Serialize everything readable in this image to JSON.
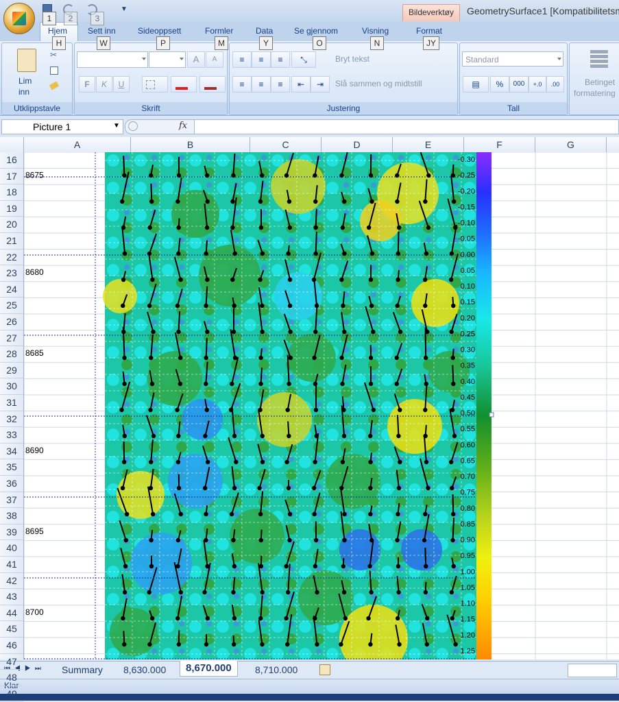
{
  "window": {
    "context_tab": "Bildeverktøy",
    "title": "GeometrySurface1  [Kompatibilitetsmodus]"
  },
  "keytips": {
    "quick1": "1",
    "quick2": "2",
    "quick3": "3",
    "hjem": "H",
    "sett_inn": "W",
    "sideoppsett": "P",
    "formler": "M",
    "data": "Y",
    "se_gjennom": "O",
    "visning": "N",
    "format": "JY"
  },
  "tabs": {
    "hjem": "Hjem",
    "sett_inn": "Sett inn",
    "sideoppsett": "Sideoppsett",
    "formler": "Formler",
    "data": "Data",
    "se_gjennom": "Se gjennom",
    "visning": "Visning",
    "format": "Format"
  },
  "ribbon": {
    "clipboard": {
      "paste_label": "Lim",
      "paste_label2": "inn",
      "group": "Utklippstavle"
    },
    "font": {
      "bold": "F",
      "italic": "K",
      "underline": "U",
      "grow": "A",
      "shrink": "A",
      "group": "Skrift"
    },
    "alignment": {
      "wrap": "Bryt tekst",
      "merge": "Slå sammen og midtstill",
      "group": "Justering"
    },
    "number": {
      "format": "Standard",
      "percent": "%",
      "thousands": "000",
      "group": "Tall"
    },
    "styles": {
      "label1": "Betinget",
      "label2": "formatering"
    }
  },
  "formula_bar": {
    "name_box": "Picture 1",
    "fx": "fx",
    "content": ""
  },
  "columns": [
    "A",
    "B",
    "C",
    "D",
    "E",
    "F",
    "G"
  ],
  "rows": [
    "16",
    "17",
    "18",
    "19",
    "20",
    "21",
    "22",
    "23",
    "24",
    "25",
    "26",
    "27",
    "28",
    "29",
    "30",
    "31",
    "32",
    "33",
    "34",
    "35",
    "36",
    "37",
    "38",
    "39",
    "40",
    "41",
    "42",
    "43",
    "44",
    "45",
    "46",
    "47",
    "48",
    "49"
  ],
  "cells": {
    "a17": "8675",
    "a23": "8680",
    "a28": "8685",
    "a34": "8690",
    "a39": "8695",
    "a44": "8700"
  },
  "legend": [
    "-0.30",
    "-0.25",
    "-0.20",
    "-0.15",
    "-0.10",
    "-0.05",
    "0.00",
    "0.05",
    "0.10",
    "0.15",
    "0.20",
    "0.25",
    "0.30",
    "0.35",
    "0.40",
    "0.45",
    "0.50",
    "0.55",
    "0.60",
    "0.65",
    "0.70",
    "0.75",
    "0.80",
    "0.85",
    "0.90",
    "0.95",
    "1.00",
    "1.05",
    "1.10",
    "1.15",
    "1.20",
    "1.25"
  ],
  "sheet_tabs": [
    "Summary",
    "8,630.000",
    "8,670.000",
    "8,710.000"
  ],
  "status": {
    "ready": "Klar"
  }
}
